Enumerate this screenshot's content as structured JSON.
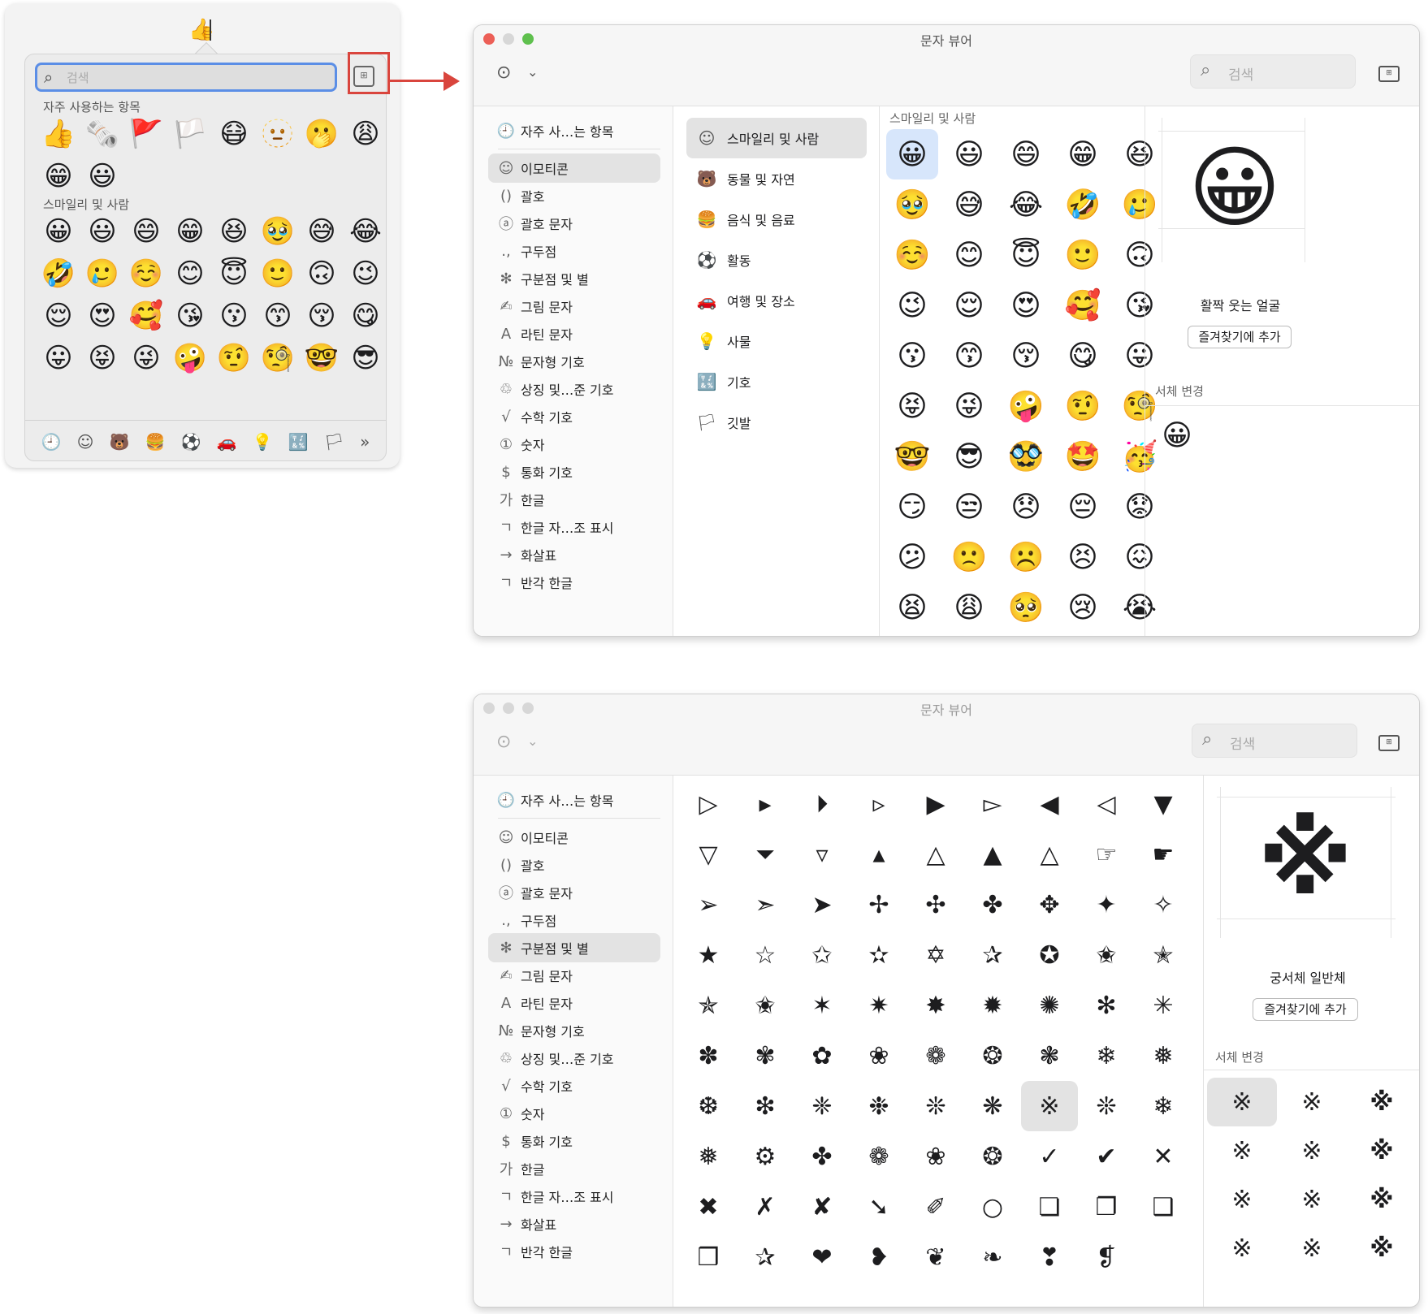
{
  "popover": {
    "typed_char": "👍",
    "search_placeholder": "검색",
    "viewer_button_label": "⊞",
    "frequent_heading": "자주 사용하는 항목",
    "frequent": [
      "👍",
      "🗞️",
      "🚩",
      "🏳️",
      "😷",
      "🫥",
      "🫢",
      "😩",
      "😁",
      "😃"
    ],
    "smileys_heading": "스마일리 및 사람",
    "smileys": [
      "😀",
      "😃",
      "😄",
      "😁",
      "😆",
      "🥹",
      "😅",
      "😂",
      "🤣",
      "🥲",
      "☺️",
      "😊",
      "😇",
      "🙂",
      "🙃",
      "😉",
      "😌",
      "😍",
      "🥰",
      "😘",
      "😗",
      "😙",
      "😚",
      "😋",
      "😛",
      "😝",
      "😜",
      "🤪",
      "🤨",
      "🧐",
      "🤓",
      "😎"
    ],
    "tabs": [
      "🕘",
      "☺",
      "🐻",
      "🍔",
      "⚽",
      "🚗",
      "💡",
      "🔣",
      "🏳",
      "»"
    ]
  },
  "window1": {
    "title": "문자 뷰어",
    "more_icon": "⊙",
    "chevron": "⌄",
    "search_placeholder": "검색",
    "sidebar": [
      {
        "icon": "🕘",
        "label": "자주 사…는 항목"
      },
      {
        "icon": "☺",
        "label": "이모티콘"
      },
      {
        "icon": "()",
        "label": "괄호"
      },
      {
        "icon": "ⓐ",
        "label": "괄호 문자"
      },
      {
        "icon": ".,",
        "label": "구두점"
      },
      {
        "icon": "✻",
        "label": "구분점 및 별"
      },
      {
        "icon": "✍",
        "label": "그림 문자"
      },
      {
        "icon": "A",
        "label": "라틴 문자"
      },
      {
        "icon": "№",
        "label": "문자형 기호"
      },
      {
        "icon": "♲",
        "label": "상징 및…준 기호"
      },
      {
        "icon": "√",
        "label": "수학 기호"
      },
      {
        "icon": "①",
        "label": "숫자"
      },
      {
        "icon": "$",
        "label": "통화 기호"
      },
      {
        "icon": "가",
        "label": "한글"
      },
      {
        "icon": "ㄱ",
        "label": "한글 자…조 표시"
      },
      {
        "icon": "→",
        "label": "화살표"
      },
      {
        "icon": "ㄱ",
        "label": "반각 한글"
      }
    ],
    "subcategories": [
      {
        "icon": "☺",
        "label": "스마일리 및 사람"
      },
      {
        "icon": "🐻",
        "label": "동물 및 자연"
      },
      {
        "icon": "🍔",
        "label": "음식 및 음료"
      },
      {
        "icon": "⚽",
        "label": "활동"
      },
      {
        "icon": "🚗",
        "label": "여행 및 장소"
      },
      {
        "icon": "💡",
        "label": "사물"
      },
      {
        "icon": "🔣",
        "label": "기호"
      },
      {
        "icon": "🏳",
        "label": "깃발"
      }
    ],
    "grid_heading": "스마일리 및 사람",
    "grid": [
      "😀",
      "😃",
      "😄",
      "😁",
      "😆",
      "🥹",
      "😅",
      "😂",
      "🤣",
      "🥲",
      "☺️",
      "😊",
      "😇",
      "🙂",
      "🙃",
      "😉",
      "😌",
      "😍",
      "🥰",
      "😘",
      "😗",
      "😙",
      "😚",
      "😋",
      "😛",
      "😝",
      "😜",
      "🤪",
      "🤨",
      "🧐",
      "🤓",
      "😎",
      "🥸",
      "🤩",
      "🥳",
      "😏",
      "😒",
      "😞",
      "😔",
      "😟",
      "😕",
      "🙁",
      "☹️",
      "😣",
      "😖",
      "😫",
      "😩",
      "🥺",
      "😢",
      "😭"
    ],
    "detail_char": "😀",
    "detail_name": "활짝 웃는 얼굴",
    "fav_button": "즐겨찾기에 추가",
    "font_heading": "서체 변경",
    "font_variants": [
      "😀"
    ]
  },
  "window2": {
    "title": "문자 뷰어",
    "search_placeholder": "검색",
    "grid": [
      "▷",
      "▸",
      "⏵",
      "▹",
      "▶",
      "▻",
      "◀",
      "◁",
      "▼",
      "▽",
      "⏷",
      "▿",
      "▴",
      "△",
      "▲",
      "△",
      "☞",
      "☛",
      "➢",
      "➣",
      "➤",
      "✢",
      "✣",
      "✤",
      "✥",
      "✦",
      "✧",
      "★",
      "☆",
      "✩",
      "✫",
      "✡",
      "✰",
      "✪",
      "✬",
      "✭",
      "✯",
      "✬",
      "✶",
      "✷",
      "✸",
      "✹",
      "✺",
      "✻",
      "✳",
      "✽",
      "✾",
      "✿",
      "❀",
      "❁",
      "❂",
      "❃",
      "❄",
      "❅",
      "❆",
      "❇",
      "❈",
      "❉",
      "❊",
      "❋",
      "※",
      "❊",
      "❄",
      "❅",
      "⚙",
      "✤",
      "❁",
      "❀",
      "❂",
      "✓",
      "✔",
      "✕",
      "✖",
      "✗",
      "✘",
      "➘",
      "✐",
      "○",
      "❏",
      "❐",
      "❑",
      "❒",
      "✰",
      "❤",
      "❥",
      "❦",
      "❧",
      "❣",
      "❡"
    ],
    "selected_index": 60,
    "detail_char": "※",
    "detail_name": "궁서체 일반체",
    "fav_button": "즐겨찾기에 추가",
    "font_heading": "서체 변경",
    "font_variants": [
      "※",
      "※",
      "※",
      "※",
      "※",
      "※",
      "※",
      "※",
      "※",
      "※",
      "※",
      "※"
    ]
  }
}
